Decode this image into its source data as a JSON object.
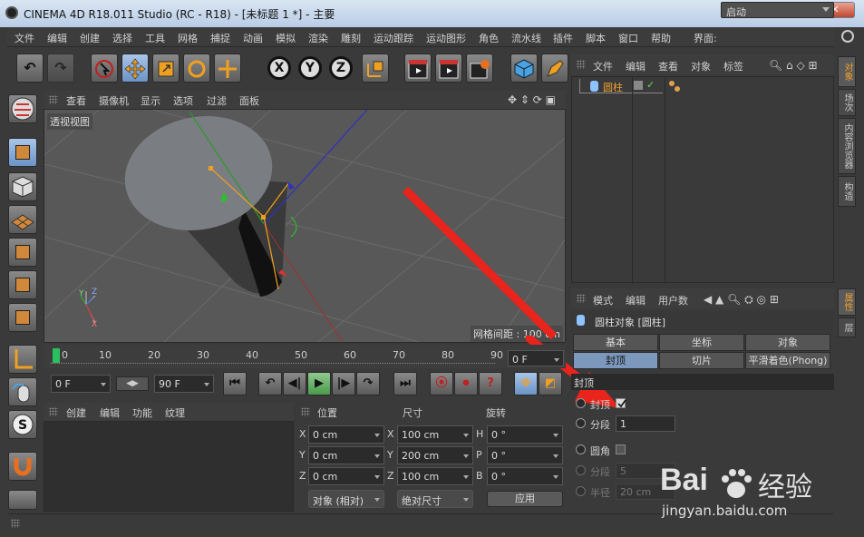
{
  "window": {
    "title": "CINEMA 4D R18.011 Studio (RC - R18) - [未标题 1 *] - 主要",
    "min": "▁",
    "max": "□",
    "close": "✕"
  },
  "menu": [
    "文件",
    "编辑",
    "创建",
    "选择",
    "工具",
    "网格",
    "捕捉",
    "动画",
    "模拟",
    "渲染",
    "雕刻",
    "运动跟踪",
    "运动图形",
    "角色",
    "流水线",
    "插件",
    "脚本",
    "窗口",
    "帮助"
  ],
  "interface": {
    "label": "界面:",
    "value": "启动"
  },
  "toolbar": {
    "x": "X",
    "y": "Y",
    "z": "Z"
  },
  "viewport": {
    "menu": [
      "查看",
      "摄像机",
      "显示",
      "选项",
      "过滤",
      "面板"
    ],
    "view_name": "透视视图",
    "grid_spacing": "网格间距 : 100 cm",
    "axis": {
      "y": "Y",
      "z": "Z",
      "x": "X"
    }
  },
  "timeline": {
    "ticks": [
      "0",
      "10",
      "20",
      "30",
      "40",
      "50",
      "60",
      "70",
      "80",
      "90"
    ],
    "current": "0 F",
    "start": "0 F",
    "end": "90 F"
  },
  "material": {
    "menu": [
      "创建",
      "编辑",
      "功能",
      "纹理"
    ]
  },
  "coords": {
    "headers": {
      "pos": "位置",
      "size": "尺寸",
      "rot": "旋转"
    },
    "pos_labels": [
      "X",
      "Y",
      "Z"
    ],
    "size_labels": [
      "X",
      "Y",
      "Z"
    ],
    "rot_labels": [
      "H",
      "P",
      "B"
    ],
    "pos": [
      "0 cm",
      "0 cm",
      "0 cm"
    ],
    "size": [
      "100 cm",
      "200 cm",
      "100 cm"
    ],
    "rot": [
      "0 °",
      "0 °",
      "0 °"
    ],
    "mode": "对象 (相对)",
    "size_mode": "绝对尺寸",
    "apply": "应用"
  },
  "object_manager": {
    "menu": [
      "文件",
      "编辑",
      "查看",
      "对象",
      "标签"
    ],
    "objects": [
      {
        "name": "圆柱"
      }
    ]
  },
  "attribute_manager": {
    "menu": [
      "模式",
      "编辑",
      "用户数"
    ],
    "title": "圆柱对象 [圆柱]",
    "tabs_row1": [
      "基本",
      "坐标",
      "对象"
    ],
    "tabs_row2": [
      "封顶",
      "切片",
      "平滑着色(Phong)"
    ],
    "section": "封顶",
    "params": {
      "caps": {
        "label": "封顶",
        "checked": true
      },
      "segments": {
        "label": "分段",
        "value": "1"
      },
      "fillet": {
        "label": "圆角",
        "checked": false
      },
      "fillet_segments": {
        "label": "分段",
        "value": "5"
      },
      "radius": {
        "label": "半径",
        "value": "20 cm"
      }
    }
  },
  "right_tabs_top": [
    "对象",
    "场次",
    "内容浏览器",
    "构造"
  ],
  "right_tabs_bottom": [
    "属性",
    "层"
  ],
  "watermark": {
    "brand": "Bai",
    "brand2": "经验",
    "url": "jingyan.baidu.com"
  },
  "colors": {
    "accent": "#f0a030",
    "selected_tab": "#7c98bd",
    "arrow": "#e8241c"
  }
}
